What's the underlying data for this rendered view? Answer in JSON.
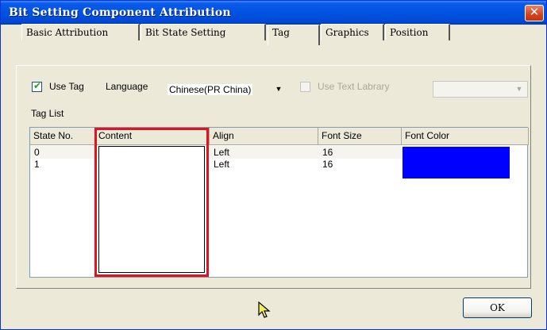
{
  "window": {
    "title": "Bit Setting Component Attribution",
    "close_glyph": "✕"
  },
  "tabs": [
    {
      "label": "Basic Attribution",
      "active": false
    },
    {
      "label": "Bit State Setting",
      "active": false
    },
    {
      "label": "Tag",
      "active": true
    },
    {
      "label": "Graphics",
      "active": false
    },
    {
      "label": "Position",
      "active": false
    }
  ],
  "options": {
    "use_tag_label": "Use Tag",
    "use_tag_checked": true,
    "language_label": "Language",
    "language_value": "Chinese(PR China)",
    "use_text_library_label": "Use Text Labrary",
    "use_text_library_checked": false,
    "text_library_value": ""
  },
  "tag_list": {
    "label": "Tag List",
    "columns": [
      "State No.",
      "Content",
      "Align",
      "Font Size",
      "Font Color"
    ],
    "rows": [
      {
        "state_no": "0",
        "content": "",
        "align": "Left",
        "font_size": "16",
        "font_color": "#0000ff"
      },
      {
        "state_no": "1",
        "content": "",
        "align": "Left",
        "font_size": "16",
        "font_color": "#0000ff"
      }
    ]
  },
  "footer": {
    "ok_label": "OK"
  },
  "icons": {
    "check": "check-icon",
    "dropdown": "dropdown-arrow-icon",
    "cursor": "mouse-pointer-icon"
  },
  "colors": {
    "title_bar": "#0053e1",
    "highlight": "#e0141e",
    "font_color_swatch": "#0000ff"
  }
}
